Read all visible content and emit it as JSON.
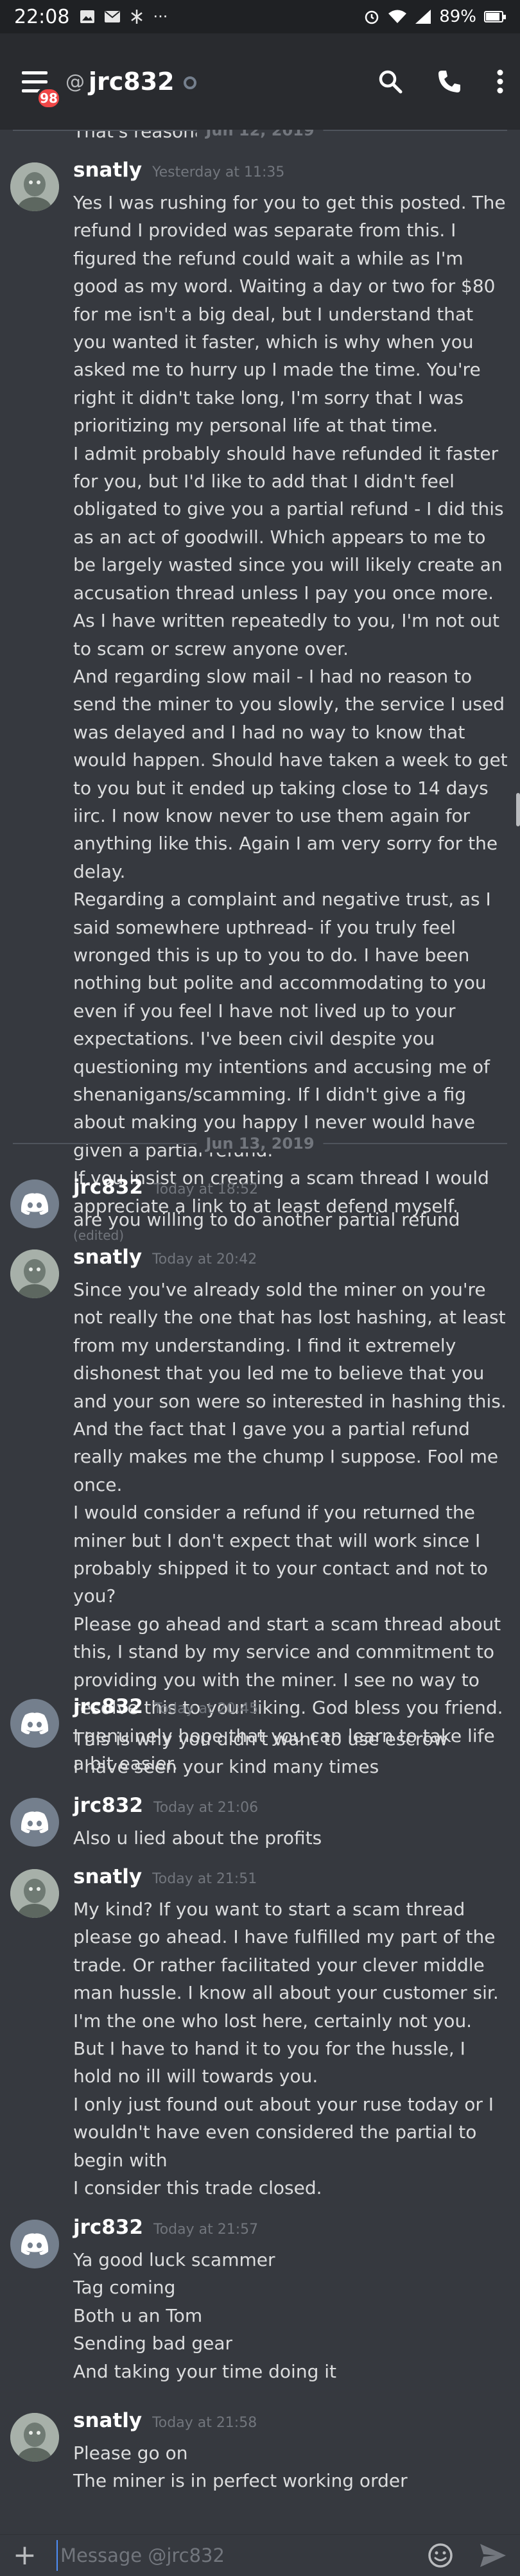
{
  "status_bar": {
    "time": "22:08",
    "left_icons": [
      "image-icon",
      "mail-icon",
      "network-icon",
      "more-icon"
    ],
    "battery_level": 0.89,
    "battery_text": "89%"
  },
  "header": {
    "unread_badge": "98",
    "at_symbol": "@",
    "channel_name": "jrc832",
    "presence": "offline"
  },
  "previous_message_tail": "That's reasonable",
  "dividers": [
    {
      "label": "Jun 12, 2019"
    },
    {
      "label": "Jun 13, 2019"
    }
  ],
  "messages": [
    {
      "author": "snatly",
      "timestamp": "Yesterday at 11:35",
      "lines": [
        "Yes I was rushing for you to get this posted. The refund I provided was separate from this. I figured the refund could wait a while as I'm good as my word. Waiting a day or two for $80 for me isn't a big deal, but I understand that you wanted it faster, which is why when you asked me to hurry up I made the time. You're right it didn't take long, I'm sorry that I was prioritizing my personal life at that time.",
        "I admit probably should have refunded it faster for you, but I'd like to add that I didn't feel obligated to give you a partial refund - I did this as an act of goodwill. Which appears to me to be largely wasted since you will likely create an accusation thread unless I pay you once more. As I have written repeatedly to you, I'm not out to scam or screw anyone over.",
        "And regarding slow mail - I had no reason to send the miner to you slowly, the service I used was delayed and I had no way to know that would happen. Should have taken a week to get to you but it ended up taking close to 14 days iirc. I now know never to use them again for anything like this. Again I am very sorry for the delay.",
        "Regarding a complaint and negative trust, as I said somewhere upthread- if you truly feel wronged this is up to you to do. I have been nothing but polite and accommodating to you even if you feel I have not lived up to your expectations. I've been civil despite you questioning my intentions and accusing me of shenanigans/scamming. If I didn't give a fig about making you happy I never would have given a partial refund.",
        "If you insist on creating a scam thread I would appreciate a link to at least defend myself."
      ],
      "edited_label": "(edited)"
    },
    {
      "author": "jrc832",
      "timestamp": "Today at 18:52",
      "lines": [
        "are you willing to do another partial refund"
      ]
    },
    {
      "author": "snatly",
      "timestamp": "Today at 20:42",
      "lines": [
        "Since you've already sold the miner on you're not really the one that has lost hashing, at least from my understanding. I find it extremely dishonest that you led me to believe that you and your son were so interested in hashing this. And the fact that I gave you a partial refund really makes me the chump I suppose. Fool me once.",
        "I would consider a refund if you returned the miner but I don't expect that will work since I probably shipped it to your contact and not to you?",
        "Please go ahead and start a scam thread about this, I stand by my service and commitment to providing you with the miner. I see no way to resolve this to your liking. God bless you friend. I genuinely hope that you can learn to take life a bit easier."
      ]
    },
    {
      "author": "jrc832",
      "timestamp": "Today at 20:45",
      "lines": [
        "This is why you didn't want to use escrow",
        "I have seen your kind many times"
      ]
    },
    {
      "author": "jrc832",
      "timestamp": "Today at 21:06",
      "lines": [
        "Also u lied about the profits"
      ]
    },
    {
      "author": "snatly",
      "timestamp": "Today at 21:51",
      "lines": [
        "My kind? If you want to start a scam thread please go ahead. I have fulfilled my part of the trade. Or rather facilitated your clever middle man hussle. I know all about your customer sir. I'm the one who lost here, certainly not you.",
        "But I have to hand it to you for the hussle, I hold no ill will towards you.",
        "I only just found out about your ruse today or I wouldn't have even considered the partial to begin with",
        "I consider this trade closed."
      ]
    },
    {
      "author": "jrc832",
      "timestamp": "Today at 21:57",
      "lines": [
        "Ya good luck scammer",
        "Tag coming",
        "Both u an Tom",
        "Sending bad gear",
        "And taking your time doing it"
      ]
    },
    {
      "author": "snatly",
      "timestamp": "Today at 21:58",
      "lines": [
        "Please go on",
        "The miner is in perfect working order"
      ]
    }
  ],
  "composer": {
    "plus_icon": "plus-icon",
    "placeholder": "Message @jrc832",
    "emoji_icon": "emoji-icon",
    "send_icon": "send-icon"
  },
  "colors": {
    "background": "#36393f",
    "header": "#292b2f",
    "badge": "#f04747",
    "text": "#dcddde",
    "muted": "#72767d"
  }
}
